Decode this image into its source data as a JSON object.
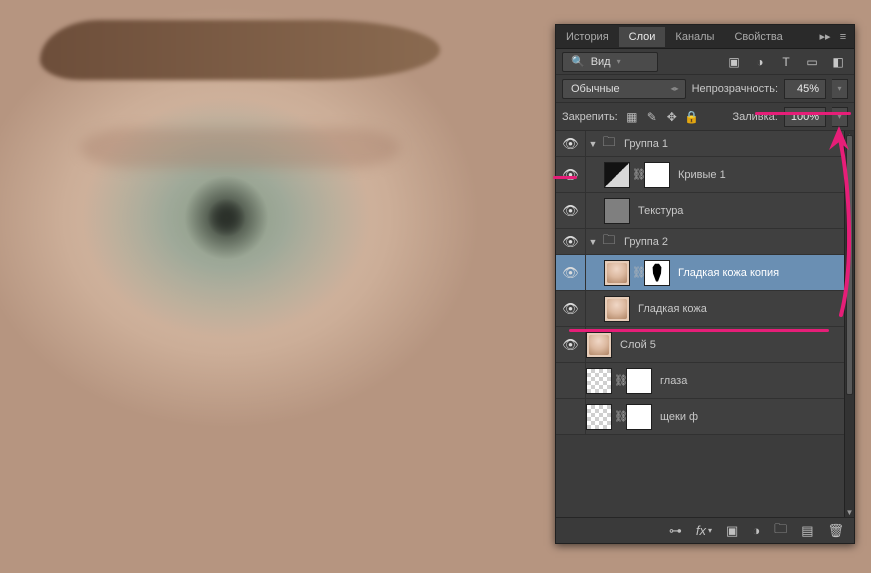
{
  "tabs": {
    "items": [
      "История",
      "Слои",
      "Каналы",
      "Свойства"
    ],
    "active_index": 1
  },
  "filter_row": {
    "mode": "Вид",
    "icons": [
      "image-filter-icon",
      "adjustment-filter-icon",
      "type-filter-icon",
      "shape-filter-icon",
      "smartobj-filter-icon"
    ]
  },
  "blend_row": {
    "mode": "Обычные",
    "opacity_label": "Непрозрачность:",
    "opacity_value": "45%"
  },
  "lock_row": {
    "lock_label": "Закрепить:",
    "lock_icons": [
      "lock-pixels-icon",
      "lock-brush-icon",
      "lock-move-icon",
      "lock-all-icon"
    ],
    "fill_label": "Заливка:",
    "fill_value": "100%"
  },
  "layers": [
    {
      "type": "group",
      "depth": 0,
      "visible": true,
      "open": true,
      "name": "Группа 1"
    },
    {
      "type": "adjustment",
      "depth": 1,
      "visible": true,
      "name": "Кривые 1",
      "thumb": "curves",
      "has_mask": true
    },
    {
      "type": "layer",
      "depth": 1,
      "visible": true,
      "name": "Текстура",
      "thumb": "tex"
    },
    {
      "type": "group",
      "depth": 0,
      "visible": true,
      "open": true,
      "name": "Группа 2"
    },
    {
      "type": "layer",
      "depth": 1,
      "visible": true,
      "name": "Гладкая кожа копия",
      "thumb": "face",
      "has_mask": true,
      "selected": true
    },
    {
      "type": "layer",
      "depth": 1,
      "visible": true,
      "name": "Гладкая кожа",
      "thumb": "face"
    },
    {
      "type": "layer",
      "depth": 0,
      "visible": true,
      "name": "Слой 5",
      "thumb": "face"
    },
    {
      "type": "layer",
      "depth": 0,
      "visible": false,
      "name": "глаза",
      "thumb": "checker",
      "has_mask": true
    },
    {
      "type": "layer",
      "depth": 0,
      "visible": false,
      "name": "щеки ф",
      "thumb": "checker",
      "has_mask": true
    }
  ],
  "bottom_icons": [
    "link-icon",
    "fx-icon",
    "mask-icon",
    "adjustment-circle-icon",
    "group-folder-icon",
    "new-layer-icon",
    "trash-icon"
  ]
}
